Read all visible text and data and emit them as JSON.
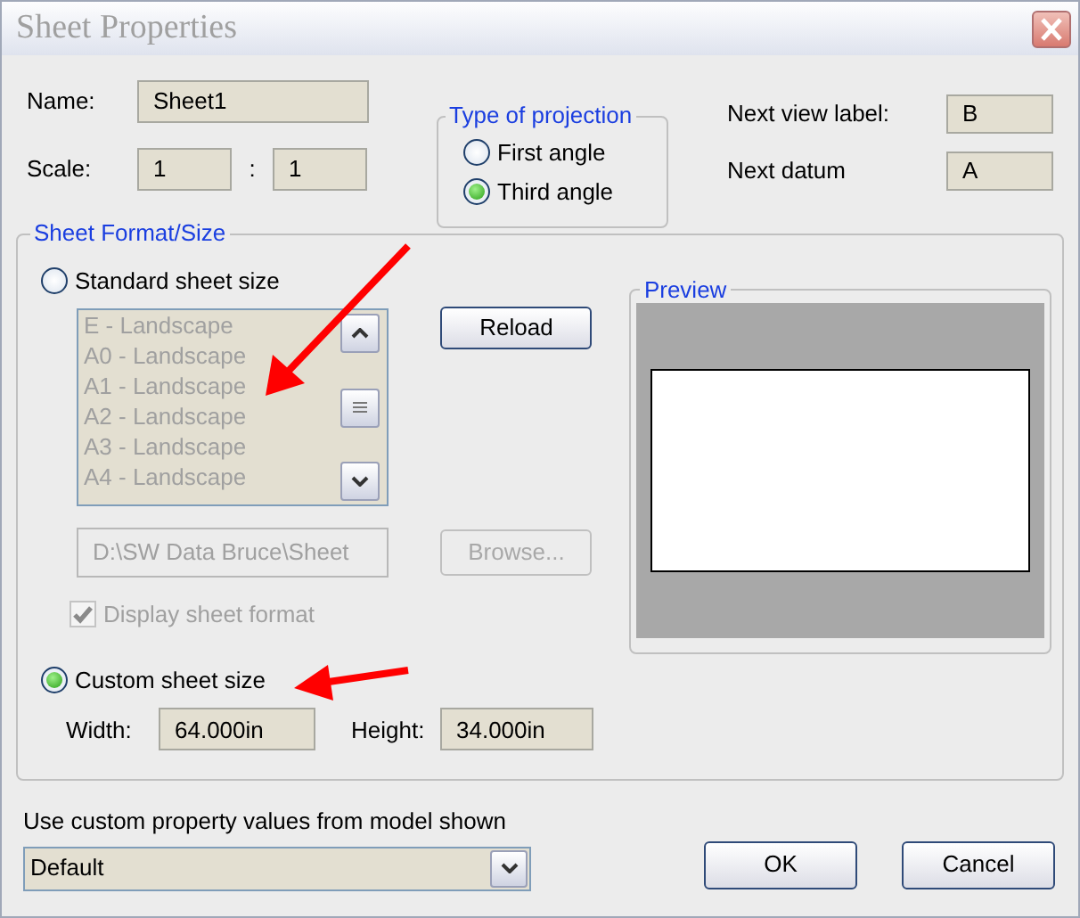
{
  "window": {
    "title": "Sheet Properties"
  },
  "name": {
    "label": "Name:",
    "value": "Sheet1"
  },
  "scale": {
    "label": "Scale:",
    "numerator": "1",
    "separator": ":",
    "denominator": "1"
  },
  "projection": {
    "title": "Type of projection",
    "options": [
      {
        "label": "First angle",
        "selected": false
      },
      {
        "label": "Third angle",
        "selected": true
      }
    ]
  },
  "next_view_label": {
    "label": "Next view label:",
    "value": "B"
  },
  "next_datum": {
    "label": "Next datum",
    "value": "A"
  },
  "sheet_format": {
    "title": "Sheet Format/Size",
    "standard": {
      "label": "Standard sheet size",
      "selected": false
    },
    "sizes": [
      "E - Landscape",
      "A0 - Landscape",
      "A1 - Landscape",
      "A2 - Landscape",
      "A3 - Landscape",
      "A4 - Landscape"
    ],
    "reload": "Reload",
    "path": "D:\\SW Data Bruce\\Sheet",
    "browse": {
      "label": "Browse...",
      "disabled": true
    },
    "display_format": {
      "label": "Display sheet format",
      "checked": true,
      "disabled": true
    },
    "custom": {
      "label": "Custom sheet size",
      "selected": true
    },
    "width": {
      "label": "Width:",
      "value": "64.000in"
    },
    "height": {
      "label": "Height:",
      "value": "34.000in"
    },
    "preview": {
      "title": "Preview"
    }
  },
  "custom_property": {
    "label": "Use custom property values from model shown",
    "value": "Default"
  },
  "buttons": [
    "OK",
    "Cancel"
  ]
}
